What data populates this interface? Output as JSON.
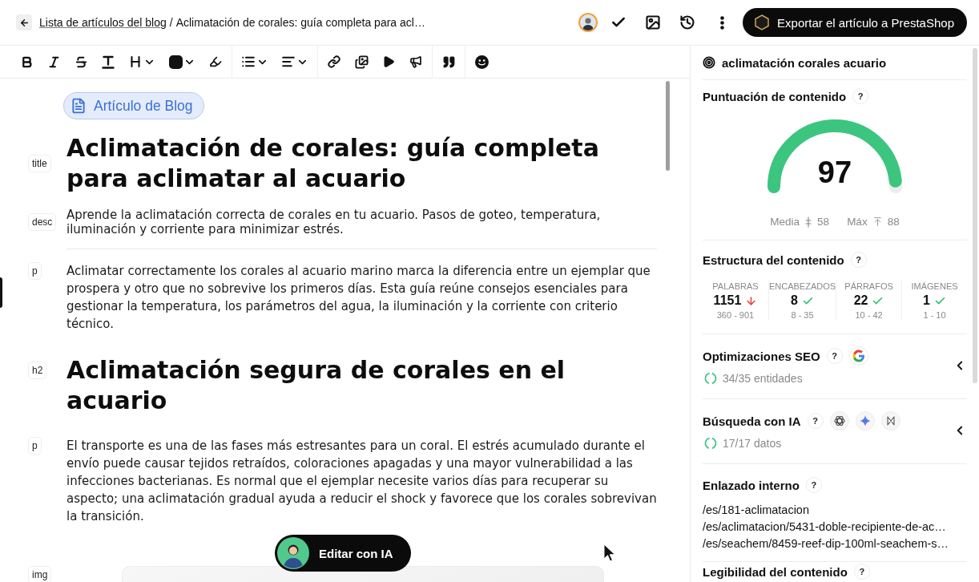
{
  "header": {
    "breadcrumb_link": "Lista de artículos del blog",
    "breadcrumb_separator": "/",
    "breadcrumb_current": "Aclimatación de corales: guía completa para acl…",
    "export_button": "Exportar el artículo a PrestaShop"
  },
  "editor": {
    "badge": "Artículo de Blog",
    "blocks": [
      {
        "kind": "title",
        "tag": "title",
        "text": "Aclimatación de corales: guía completa para aclimatar al acuario"
      },
      {
        "kind": "description",
        "tag": "desc",
        "text": "Aprende la aclimatación correcta de corales en tu acuario. Pasos de goteo, temperatura, iluminación y corriente para minimizar estrés."
      },
      {
        "kind": "paragraph",
        "tag": "p",
        "text": "Aclimatar correctamente los corales al acuario marino marca la diferencia entre un ejemplar que prospera y otro que no sobrevive los primeros días. Esta guía reúne consejos esenciales para gestionar la temperatura, los parámetros del agua, la iluminación y la corriente con criterio técnico."
      },
      {
        "kind": "heading",
        "tag": "h2",
        "text": "Aclimatación segura de corales en el acuario"
      },
      {
        "kind": "paragraph",
        "tag": "p",
        "text": "El transporte es una de las fases más estresantes para un coral. El estrés acumulado durante el envío puede causar tejidos retraídos, coloraciones apagadas y una mayor vulnerabilidad a las infecciones bacterianas. Es normal que el ejemplar necesite varios días para recuperar su aspecto; una aclimatación gradual ayuda a reducir el shock y favorece que los corales sobrevivan la transición."
      },
      {
        "kind": "image",
        "tag": "img"
      }
    ],
    "ai_button": "Editar con IA"
  },
  "panel": {
    "keyword": "aclimatación corales acuario",
    "score": {
      "title": "Puntuación de contenido",
      "help": "?",
      "value": "97",
      "level": 0.97,
      "average_label": "Media",
      "average": "58",
      "max_label": "Máx",
      "max": "88"
    },
    "structure": {
      "title": "Estructura del contenido",
      "help": "?",
      "metrics": [
        {
          "label": "PALABRAS",
          "value": "1151",
          "ok": false,
          "range": "360 - 901"
        },
        {
          "label": "ENCABEZADOS",
          "value": "8",
          "ok": true,
          "range": "8 - 35"
        },
        {
          "label": "PÁRRAFOS",
          "value": "22",
          "ok": true,
          "range": "10 - 42"
        },
        {
          "label": "IMÁGENES",
          "value": "1",
          "ok": true,
          "range": "1 - 10"
        }
      ]
    },
    "sections": [
      {
        "kind": "seo",
        "title": "Optimizaciones SEO",
        "help": "?",
        "status": "34/35 entidades",
        "expanded": false
      },
      {
        "kind": "ai",
        "title": "Búsqueda con IA",
        "help": "?",
        "status": "17/17 datos",
        "expanded": false
      },
      {
        "kind": "links",
        "title": "Enlazado interno",
        "help": "?",
        "links": [
          "/es/181-aclimatacion",
          "/es/aclimatacion/5431-doble-recipiente-de-ac…",
          "/es/seachem/8459-reef-dip-100ml-seachem-s…"
        ]
      },
      {
        "kind": "readability",
        "title": "Legibilidad del contenido",
        "help": "?"
      }
    ]
  }
}
